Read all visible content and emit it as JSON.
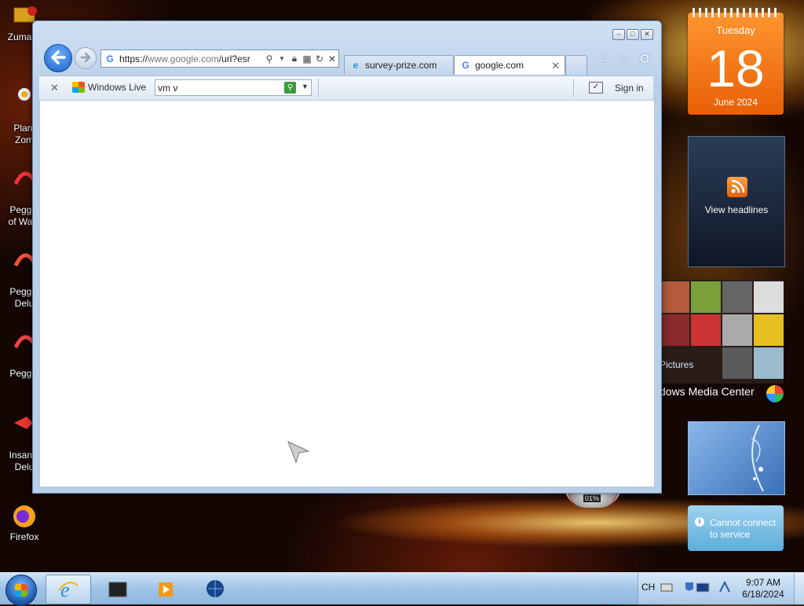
{
  "desktop": {
    "icons": [
      {
        "label": "Zuma D"
      },
      {
        "label": "Plant\nZom"
      },
      {
        "label": "Peggle\nof Warc"
      },
      {
        "label": "Peggle\nDelu"
      },
      {
        "label": "Peggle"
      },
      {
        "label": "Insanio\nDelu"
      },
      {
        "label": "Firefox"
      }
    ]
  },
  "gadgets": {
    "calendar": {
      "weekday": "Tuesday",
      "day": "18",
      "month_year": "June 2024"
    },
    "feed": {
      "label": "View headlines"
    },
    "media_center": {
      "pictures_label": "Pictures",
      "title": "dows Media Center"
    },
    "gauge": {
      "value": "01%"
    },
    "service": {
      "message": "Cannot connect\nto service"
    }
  },
  "browser": {
    "address": {
      "scheme": "https://",
      "host": "www.google.com",
      "path": "/url?esr"
    },
    "tabs": [
      {
        "label": "survey-prize.com",
        "icon": "ie-icon"
      },
      {
        "label": "google.com",
        "icon": "google-g-icon"
      }
    ],
    "toolbar": {
      "brand": "Windows Live",
      "search_value": "vm v",
      "sign_in": "Sign in"
    }
  },
  "taskbar": {
    "lang": "CH",
    "time": "9:07 AM",
    "date": "6/18/2024"
  },
  "colors": {
    "accent": "#1a5fc6",
    "calendar": "#f07a1a"
  }
}
